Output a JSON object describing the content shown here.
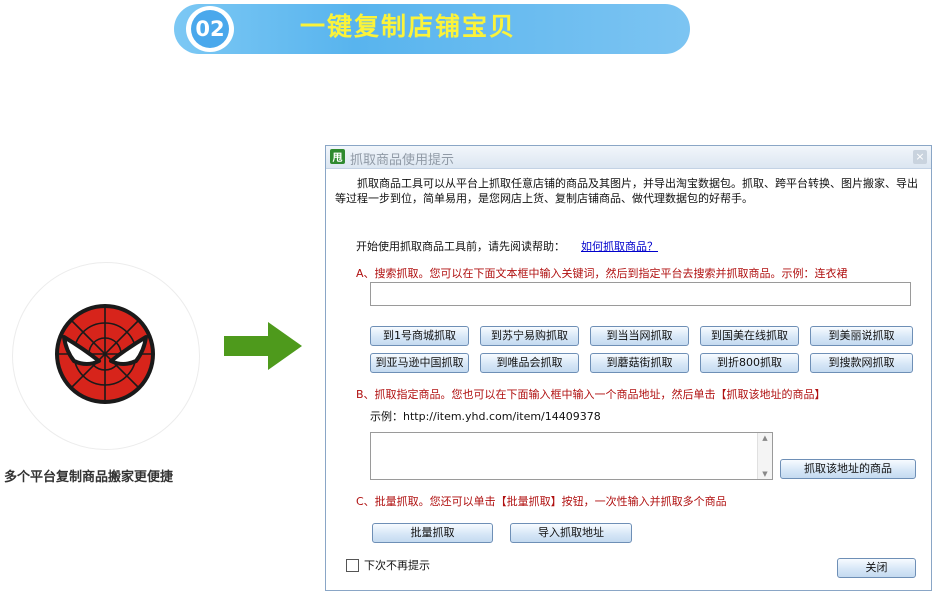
{
  "header": {
    "step": "02",
    "title": "一键复制店铺宝贝"
  },
  "logo": {
    "caption": "多个平台复制商品搬家更便捷",
    "icon": "spiderman-mask-icon"
  },
  "dialog": {
    "app_icon": "甩",
    "title": "抓取商品使用提示",
    "close": "×",
    "intro": "抓取商品工具可以从平台上抓取任意店铺的商品及其图片，并导出淘宝数据包。抓取、跨平台转换、图片搬家、导出等过程一步到位，简单易用，是您网店上货、复制店铺商品、做代理数据包的好帮手。",
    "help_prompt": "开始使用抓取商品工具前，请先阅读帮助：",
    "help_link": "如何抓取商品？",
    "section_a": "A、搜索抓取。您可以在下面文本框中输入关键词，然后到指定平台去搜索并抓取商品。示例：连衣裙",
    "keyword_value": "",
    "platform_buttons": [
      "到1号商城抓取",
      "到苏宁易购抓取",
      "到当当网抓取",
      "到国美在线抓取",
      "到美丽说抓取",
      "到亚马逊中国抓取",
      "到唯品会抓取",
      "到蘑菇街抓取",
      "到折800抓取",
      "到搜款网抓取"
    ],
    "section_b": "B、抓取指定商品。您也可以在下面输入框中输入一个商品地址，然后单击【抓取该地址的商品】",
    "example": "示例：http://item.yhd.com/item/14409378",
    "url_value": "",
    "fetch_url_button": "抓取该地址的商品",
    "section_c": "C、批量抓取。您还可以单击【批量抓取】按钮，一次性输入并抓取多个商品",
    "batch_button": "批量抓取",
    "import_button": "导入抓取地址",
    "dont_show": "下次不再提示",
    "close_button": "关闭"
  },
  "colors": {
    "header_blue": "#58b4ee",
    "title_yellow": "#fbf33a",
    "arrow_green": "#4e9a1c",
    "section_red": "#b01010"
  }
}
